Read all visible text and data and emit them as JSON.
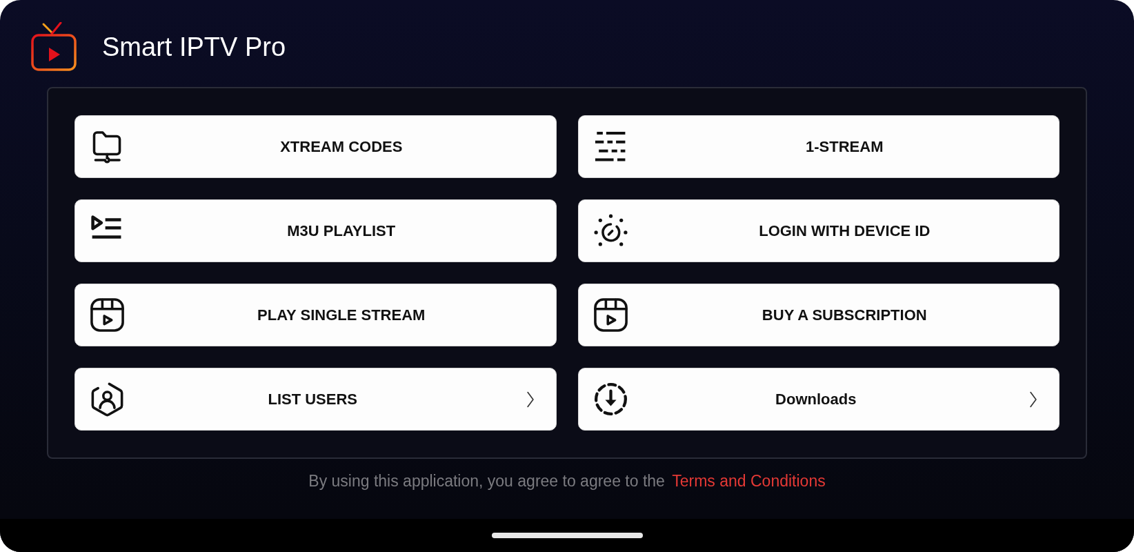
{
  "header": {
    "title": "Smart IPTV Pro"
  },
  "menu": {
    "items": [
      {
        "label": "XTREAM CODES",
        "kind": "folder",
        "chevron": false
      },
      {
        "label": "1-STREAM",
        "kind": "dashes",
        "chevron": false
      },
      {
        "label": "M3U PLAYLIST",
        "kind": "playlist",
        "chevron": false
      },
      {
        "label": "LOGIN WITH DEVICE ID",
        "kind": "dial",
        "chevron": false
      },
      {
        "label": "PLAY SINGLE STREAM",
        "kind": "reel",
        "chevron": false
      },
      {
        "label": "BUY A SUBSCRIPTION",
        "kind": "reel",
        "chevron": false
      },
      {
        "label": "LIST USERS",
        "kind": "user",
        "chevron": true
      },
      {
        "label": "Downloads",
        "kind": "download",
        "chevron": true
      }
    ]
  },
  "footer": {
    "text": "By using this application, you agree to agree to the",
    "link": "Terms and Conditions"
  }
}
